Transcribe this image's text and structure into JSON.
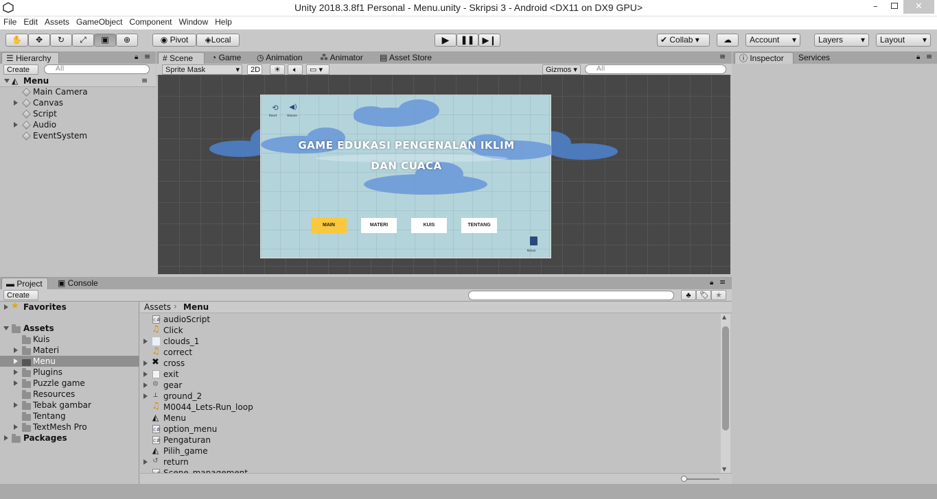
{
  "window": {
    "title": "Unity 2018.3.8f1 Personal - Menu.unity - Skripsi 3 - Android <DX11 on DX9 GPU>"
  },
  "menu": [
    "File",
    "Edit",
    "Assets",
    "GameObject",
    "Component",
    "Window",
    "Help"
  ],
  "toolbar": {
    "pivot": "Pivot",
    "local": "Local",
    "collab": "Collab",
    "account": "Account",
    "layers": "Layers",
    "layout": "Layout"
  },
  "hierarchy": {
    "tab": "Hierarchy",
    "create": "Create",
    "search_placeholder": "All",
    "scene": "Menu",
    "items": [
      "Main Camera",
      "Canvas",
      "Script",
      "Audio",
      "EventSystem"
    ]
  },
  "scene_tabs": {
    "scene": "Scene",
    "game": "Game",
    "animation": "Animation",
    "animator": "Animator",
    "asset_store": "Asset Store",
    "sprite_mask": "Sprite Mask",
    "mode_2d": "2D",
    "gizmos": "Gizmos",
    "search_placeholder": "All"
  },
  "game_screen": {
    "title_line1": "GAME EDUKASI PENGENALAN IKLIM",
    "title_line2": "DAN CUACA",
    "reset_label": "Reset",
    "volume_label": "Volume",
    "buttons": [
      "MAIN",
      "MATERI",
      "KUIS",
      "TENTANG"
    ],
    "exit_label": "Keluar",
    "main_color": "#f9c83c"
  },
  "inspector": {
    "tab": "Inspector",
    "services": "Services"
  },
  "project": {
    "tab": "Project",
    "console": "Console",
    "create": "Create",
    "favorites": "Favorites",
    "assets": "Assets",
    "folders": [
      "Kuis",
      "Materi",
      "Menu",
      "Plugins",
      "Puzzle game",
      "Resources",
      "Tebak gambar",
      "Tentang",
      "TextMesh Pro"
    ],
    "packages": "Packages",
    "breadcrumb_root": "Assets",
    "breadcrumb_current": "Menu",
    "files": [
      "audioScript",
      "Click",
      "clouds_1",
      "correct",
      "cross",
      "exit",
      "gear",
      "ground_2",
      "M0044_Lets-Run_loop",
      "Menu",
      "option_menu",
      "Pengaturan",
      "Pilih_game",
      "return",
      "Scene_management"
    ]
  }
}
